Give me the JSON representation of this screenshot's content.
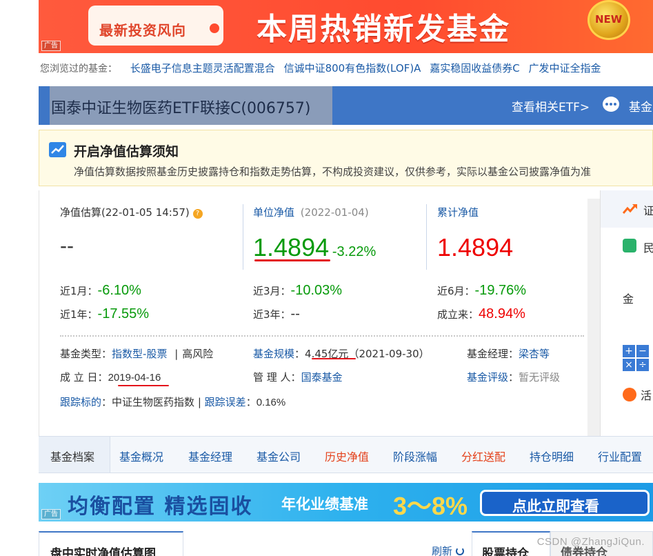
{
  "ad_top": {
    "tag": "广告",
    "pill_text": "最新投资风向",
    "headline": "本周热销新发基金",
    "badge": "NEW"
  },
  "recent": {
    "label": "您浏览过的基金：",
    "funds": [
      "长盛电子信息主题灵活配置混合",
      "信诚中证800有色指数(LOF)A",
      "嘉实稳固收益债券C",
      "广发中证全指金"
    ]
  },
  "title_bar": {
    "fund_name": "国泰中证生物医药ETF联接C(006757)",
    "etf_link": "查看相关ETF>",
    "more": "基金"
  },
  "notice": {
    "title": "开启净值估算须知",
    "text": "净值估算数据按照基金历史披露持仓和指数走势估算，不构成投资建议，仅供参考，实际以基金公司披露净值为准"
  },
  "estimate": {
    "label": "净值估算(22-01-05 14:57)",
    "value": "--"
  },
  "unit_nav": {
    "label": "单位净值",
    "date": "(2022-01-04)",
    "value": "1.4894",
    "change": "-3.22%"
  },
  "cum_nav": {
    "label": "累计净值",
    "value": "1.4894"
  },
  "returns": [
    {
      "label": "近1月：",
      "value": "-6.10%",
      "color": "green"
    },
    {
      "label": "近3月：",
      "value": "-10.03%",
      "color": "green"
    },
    {
      "label": "近6月：",
      "value": "-19.76%",
      "color": "green"
    },
    {
      "label": "近1年：",
      "value": "-17.55%",
      "color": "green"
    },
    {
      "label": "近3年：",
      "value": "--",
      "color": "plain"
    },
    {
      "label": "成立来：",
      "value": "48.94%",
      "color": "red"
    }
  ],
  "info": {
    "type_label": "基金类型",
    "type_value": "指数型-股票",
    "risk": "高风险",
    "scale_label": "基金规模",
    "scale_value": "4.45亿元",
    "scale_date": "（2021-09-30）",
    "manager_label": "基金经理",
    "manager_value": "梁杏等",
    "established_label": "成 立 日",
    "established_value": "2019-04-16",
    "admin_label": "管 理 人",
    "admin_value": "国泰基金",
    "rating_label": "基金评级",
    "rating_value": "暂无评级",
    "track_label": "跟踪标的",
    "track_value": "中证生物医药指数",
    "error_label": "跟踪误差",
    "error_value": "0.16%"
  },
  "side": {
    "item1": "证",
    "item2": "民",
    "item3": "金",
    "item4": "活"
  },
  "tabs": [
    "基金档案",
    "基金概况",
    "基金经理",
    "基金公司",
    "历史净值",
    "阶段涨幅",
    "分红送配",
    "持仓明细",
    "行业配置"
  ],
  "ad_bottom": {
    "tag": "广告",
    "t1": "均衡配置 精选固收",
    "t2": "年化业绩基准",
    "t3": "3～8%",
    "cta": "点此立即查看"
  },
  "bottom": {
    "chart_tab": "盘中实时净值估算图",
    "refresh": "刷新",
    "holdings_tab": "股票持仓",
    "bonds_tab": "债券持仓"
  },
  "watermark": "CSDN @ZhangJiQun.",
  "colors": {
    "title_bar": "#3e76c6",
    "link": "#1a5aa6",
    "up": "#e00",
    "down": "#079a0b",
    "annotation": "#e4141b"
  }
}
